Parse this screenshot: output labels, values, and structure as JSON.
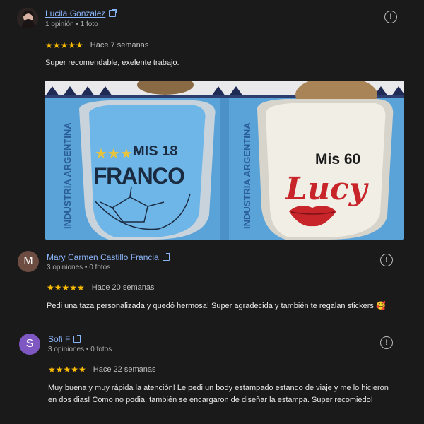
{
  "reviews": [
    {
      "name": "Lucila Gonzalez",
      "meta": "1 opinión • 1 foto",
      "stars": "★★★★★",
      "time": "Hace 7 semanas",
      "text": "Super recomendable, exelente trabajo.",
      "avatar_icon": "profile-photo"
    },
    {
      "name": "Mary Carmen Castillo Francia",
      "meta": "3 opiniones • 0 fotos",
      "stars": "★★★★★",
      "time": "Hace 20 semanas",
      "text": "Pedi una taza personalizada y quedó hermosa! Super agradecida y también te regalan stickers 🥰",
      "avatar_letter": "M",
      "avatar_color": "#6d4c41"
    },
    {
      "name": "Sofi F",
      "meta": "3 opiniones • 0 fotos",
      "stars": "★★★★★",
      "time": "Hace 22 semanas",
      "text": "Muy buena y muy rápida la atención! Le pedi un body estampado estando de viaje y me lo hicieron en dos dias! Como no podia, también se encargaron de diseñar la estampa. Super recomiedo!",
      "avatar_letter": "S",
      "avatar_color": "#7e57c2"
    }
  ],
  "photo": {
    "left_text_1": "MIS 18",
    "left_text_2": "FRANCO",
    "right_text_1": "Mis 60",
    "right_text_2": "Lucy",
    "side_text": "INDUSTRIA ARGENTINA",
    "colors": {
      "sky_blue": "#5aa3d8",
      "cup_blue": "#6fb6e8",
      "cup_white": "#f1eee6",
      "lucy_red": "#c8252b"
    }
  },
  "icons": {
    "more": "info-circle-icon",
    "edit": "edit-icon"
  }
}
